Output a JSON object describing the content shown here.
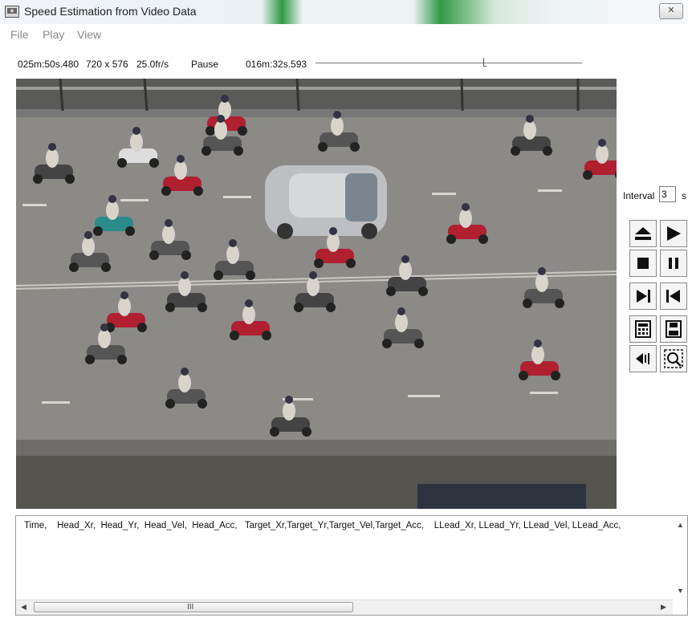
{
  "window": {
    "title": "Speed Estimation from Video Data"
  },
  "menu": [
    "File",
    "Play",
    "View"
  ],
  "info": {
    "position": "025m:50s.480",
    "resolution": "720 x 576",
    "fps": "25.0fr/s",
    "state": "Pause",
    "time": "016m:32s.593"
  },
  "slider": {
    "value_fraction": 0.63
  },
  "interval": {
    "label": "Interval",
    "value": "3",
    "unit": "s"
  },
  "controls": [
    "eject-icon",
    "play-icon",
    "stop-icon",
    "pause-icon",
    "step-forward-icon",
    "step-back-icon",
    "calculator-icon",
    "save-icon",
    "audio-icon",
    "zoom-fit-icon"
  ],
  "log": {
    "header": "Time,    Head_Xr,  Head_Yr,  Head_Vel,  Head_Acc,   Target_Xr,Target_Yr,Target_Vel,Target_Acc,    LLead_Xr, LLead_Yr, LLead_Vel, LLead_Acc,"
  },
  "hscroll": {
    "grip": "III"
  },
  "colors": {
    "accent_green": "#2f9a44",
    "road": "#898886",
    "control_glyph": "#111111"
  }
}
